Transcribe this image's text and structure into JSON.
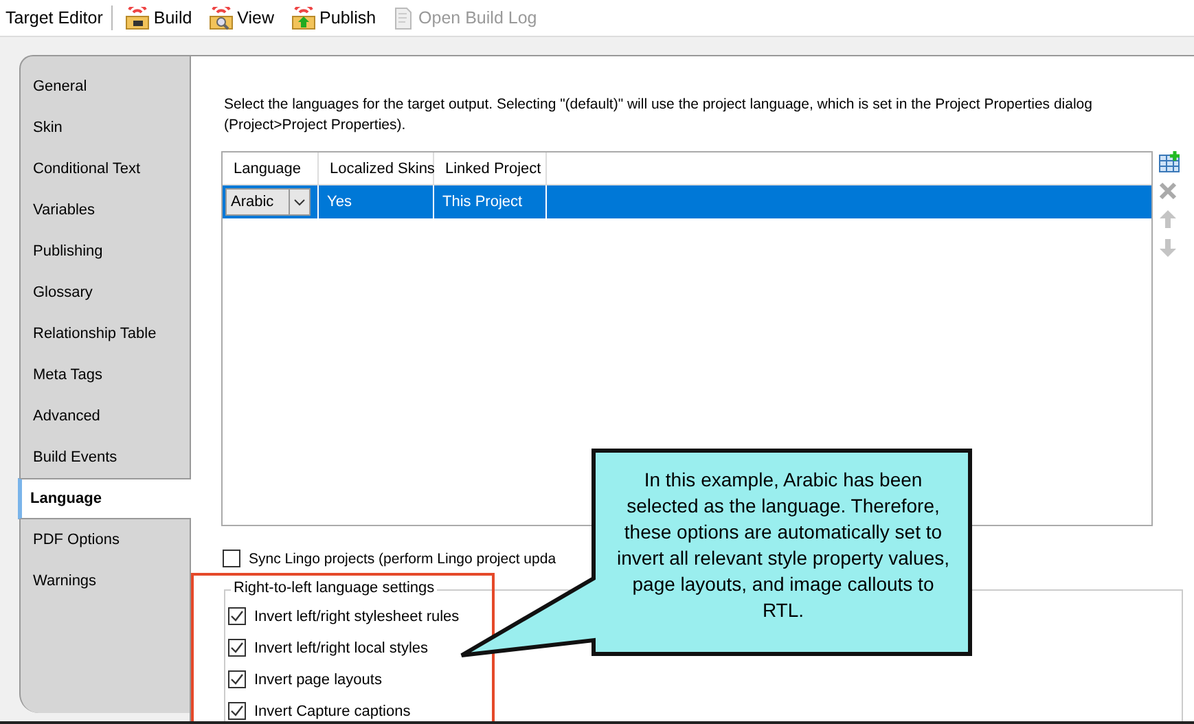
{
  "toolbar": {
    "title": "Target Editor",
    "buttons": [
      {
        "label": "Build",
        "kind": "build",
        "disabled": false
      },
      {
        "label": "View",
        "kind": "view",
        "disabled": false
      },
      {
        "label": "Publish",
        "kind": "publish",
        "disabled": false
      },
      {
        "label": "Open Build Log",
        "kind": "log",
        "disabled": true
      }
    ]
  },
  "sidebar": {
    "items": [
      {
        "label": "General",
        "selected": false
      },
      {
        "label": "Skin",
        "selected": false
      },
      {
        "label": "Conditional Text",
        "selected": false
      },
      {
        "label": "Variables",
        "selected": false
      },
      {
        "label": "Publishing",
        "selected": false
      },
      {
        "label": "Glossary",
        "selected": false
      },
      {
        "label": "Relationship Table",
        "selected": false
      },
      {
        "label": "Meta Tags",
        "selected": false
      },
      {
        "label": "Advanced",
        "selected": false
      },
      {
        "label": "Build Events",
        "selected": false
      },
      {
        "label": "Language",
        "selected": true
      },
      {
        "label": "PDF Options",
        "selected": false
      },
      {
        "label": "Warnings",
        "selected": false
      }
    ]
  },
  "description": "Select the languages for the target output. Selecting \"(default)\" will use the project language, which is set in the Project Properties dialog (Project>Project Properties).",
  "table": {
    "columns": [
      "Language",
      "Localized Skins",
      "Linked Project"
    ],
    "rows": [
      {
        "language": "Arabic",
        "localized_skins": "Yes",
        "linked_project": "This Project",
        "selected": true
      }
    ]
  },
  "side_buttons": [
    {
      "kind": "add"
    },
    {
      "kind": "delete"
    },
    {
      "kind": "up"
    },
    {
      "kind": "down"
    }
  ],
  "sync": {
    "label": "Sync Lingo projects (perform Lingo project upda",
    "checked": false
  },
  "rtl_group": {
    "title": "Right-to-left language settings",
    "options": [
      {
        "label": "Invert left/right stylesheet rules",
        "checked": true
      },
      {
        "label": "Invert left/right local styles",
        "checked": true
      },
      {
        "label": "Invert page layouts",
        "checked": true
      },
      {
        "label": "Invert Capture captions",
        "checked": true
      }
    ]
  },
  "callout": {
    "text": "In this example, Arabic has been selected as the language. Therefore, these options are automatically set to invert all relevant style property values, page layouts, and image callouts to RTL."
  }
}
